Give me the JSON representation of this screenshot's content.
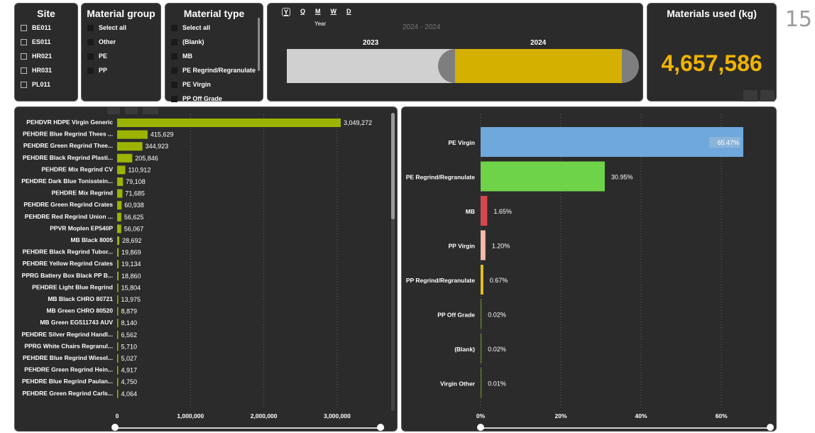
{
  "page_number": "15",
  "slicers": {
    "site": {
      "title": "Site",
      "items": [
        "BE011",
        "ES011",
        "HR021",
        "HR031",
        "PL011"
      ]
    },
    "material_group": {
      "title": "Material group",
      "items": [
        "Select all",
        "Other",
        "PE",
        "PP"
      ]
    },
    "material_type": {
      "title": "Material type",
      "items": [
        "Select all",
        "(Blank)",
        "MB",
        "PE Regrind/Regranulate",
        "PE Virgin",
        "PP Off Grade"
      ]
    }
  },
  "timeline": {
    "levels": [
      "Y",
      "Q",
      "M",
      "W",
      "D"
    ],
    "selected_level": "Y",
    "level_caption": "Year",
    "range_label": "2024 - 2024",
    "years": [
      "2023",
      "2024"
    ]
  },
  "kpi": {
    "title": "Materials used (kg)",
    "value": "4,657,586",
    "color": "#f0b400"
  },
  "colors": {
    "bar_left": "#9cb400",
    "bar_pe_virgin": "#6fa8dc",
    "bar_pe_regrind": "#6fd34a",
    "bar_mb": "#d9464f",
    "bar_pp_virgin": "#f4b9a8",
    "bar_pp_regrind": "#e8c21a",
    "bar_minor": "#6b8e23"
  },
  "chart_data": [
    {
      "type": "bar",
      "orientation": "horizontal",
      "categories": [
        "PEHDVR HDPE Virgin Generic",
        "PEHDRE Blue Regrind Thees ...",
        "PEHDRE Green Regrind Thee...",
        "PEHDRE Black Regrind Plasti...",
        "PEHDRE Mix Regrind CV",
        "PEHDRE Dark Blue Tonisstein...",
        "PEHDRE Mix Regrind",
        "PEHDRE Green Regrind Crates",
        "PEHDRE Red Regrind Union ...",
        "PPVR Moplen EP540P",
        "MB Black 8005",
        "PEHDRE Black Regrind Tubor...",
        "PEHDRE Yellow Regrind Crates",
        "PPRG Battery Box Black PP B...",
        "PEHDRE Light Blue Regrind",
        "MB Black CHRO 80721",
        "MB Green CHRO 80520",
        "MB Green EG511743 AUV",
        "PEHDRE Silver Regrind Handl...",
        "PPRG White Chairs Regranul...",
        "PEHDRE Blue Regrind Wiesel...",
        "PEHDRE Green Regrind Hein...",
        "PEHDRE Blue Regrind Paulan...",
        "PEHDRE Green Regrind Carls..."
      ],
      "values": [
        3049272,
        415629,
        344923,
        205846,
        110912,
        79108,
        71685,
        60938,
        56625,
        56067,
        28692,
        19869,
        19134,
        18860,
        15804,
        13975,
        8879,
        8140,
        6562,
        5710,
        5027,
        4917,
        4750,
        4064
      ],
      "value_labels": [
        "3,049,272",
        "415,629",
        "344,923",
        "205,846",
        "110,912",
        "79,108",
        "71,685",
        "60,938",
        "56,625",
        "56,067",
        "28,692",
        "19,869",
        "19,134",
        "18,860",
        "15,804",
        "13,975",
        "8,879",
        "8,140",
        "6,562",
        "5,710",
        "5,027",
        "4,917",
        "4,750",
        "4,064"
      ],
      "x_ticks": [
        "0",
        "1,000,000",
        "2,000,000",
        "3,000,000"
      ],
      "xlim": [
        0,
        3600000
      ]
    },
    {
      "type": "bar",
      "orientation": "horizontal",
      "categories": [
        "PE Virgin",
        "PE Regrind/Regranulate",
        "MB",
        "PP Virgin",
        "PP Regrind/Regranulate",
        "PP Off Grade",
        "(Blank)",
        "Virgin Other"
      ],
      "values": [
        65.47,
        30.95,
        1.65,
        1.2,
        0.67,
        0.02,
        0.02,
        0.01
      ],
      "value_labels": [
        "65.47%",
        "30.95%",
        "1.65%",
        "1.20%",
        "0.67%",
        "0.02%",
        "0.02%",
        "0.01%"
      ],
      "x_ticks": [
        "0%",
        "20%",
        "40%",
        "60%"
      ],
      "xlim": [
        0,
        70
      ]
    }
  ]
}
